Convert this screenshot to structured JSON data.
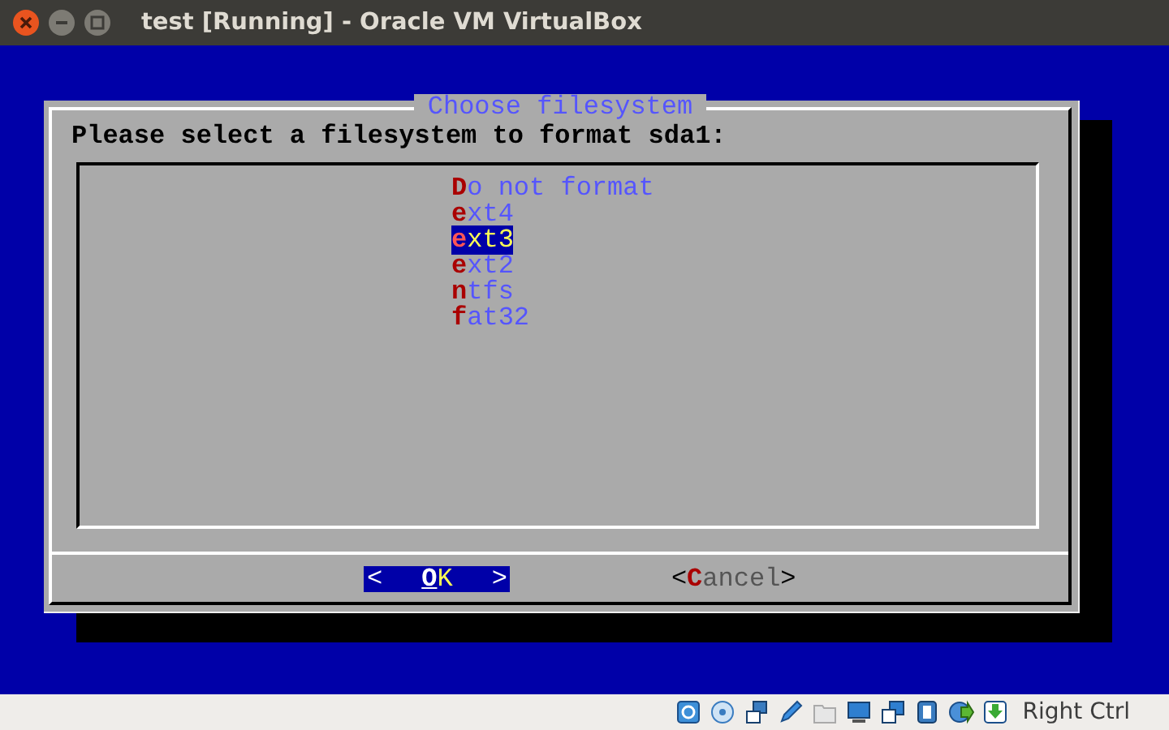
{
  "window": {
    "title": "test [Running] - Oracle VM VirtualBox"
  },
  "dialog": {
    "title": "Choose filesystem",
    "prompt": "Please select a filesystem to format sda1:",
    "items": [
      {
        "label": "Do not format",
        "selected": false
      },
      {
        "label": "ext4",
        "selected": false
      },
      {
        "label": "ext3",
        "selected": true
      },
      {
        "label": "ext2",
        "selected": false
      },
      {
        "label": "ntfs",
        "selected": false
      },
      {
        "label": "fat32",
        "selected": false
      }
    ],
    "buttons": [
      {
        "open": "<",
        "label": "OK",
        "close": ">",
        "selected": true
      },
      {
        "open": "<",
        "label": "Cancel",
        "close": ">",
        "selected": false
      }
    ]
  },
  "status_bar": {
    "host_key": "Right Ctrl"
  }
}
